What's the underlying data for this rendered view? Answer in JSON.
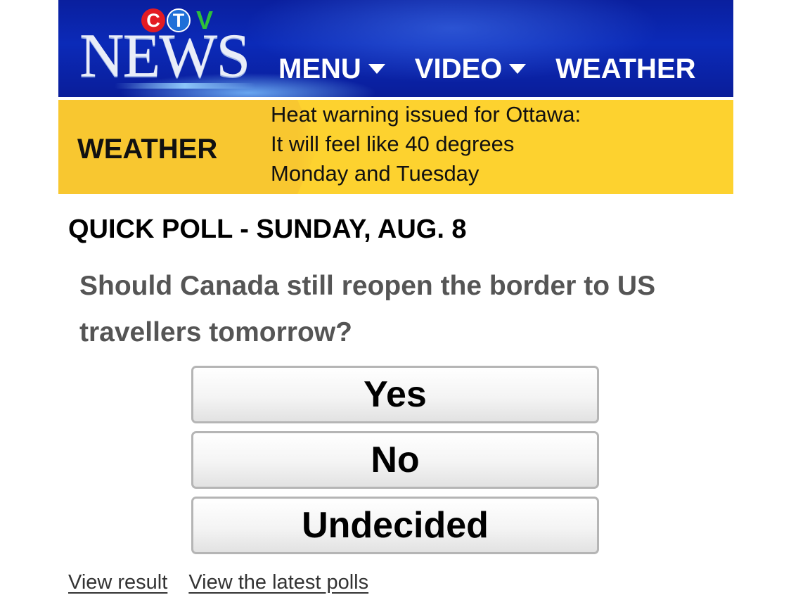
{
  "brand": {
    "ctv_letters": [
      "C",
      "T",
      "V"
    ],
    "wordmark": "NEWS",
    "colors": {
      "c": "#e31b23",
      "t": "#1f6fd8",
      "v": "#2fbf3a"
    }
  },
  "nav": {
    "items": [
      {
        "label": "MENU",
        "has_dropdown": true
      },
      {
        "label": "VIDEO",
        "has_dropdown": true
      },
      {
        "label": "WEATHER",
        "has_dropdown": false
      }
    ]
  },
  "weather_banner": {
    "label": "WEATHER",
    "lines": [
      "Heat warning issued for Ottawa:",
      "It will feel like 40 degrees",
      "Monday and Tuesday"
    ],
    "background": "#fdd22f"
  },
  "poll": {
    "title": "QUICK POLL - SUNDAY, AUG. 8",
    "question": "Should Canada still reopen the border to US travellers tomorrow?",
    "options": [
      "Yes",
      "No",
      "Undecided"
    ]
  },
  "links": {
    "view_result": "View result",
    "latest_polls": "View the latest polls"
  }
}
